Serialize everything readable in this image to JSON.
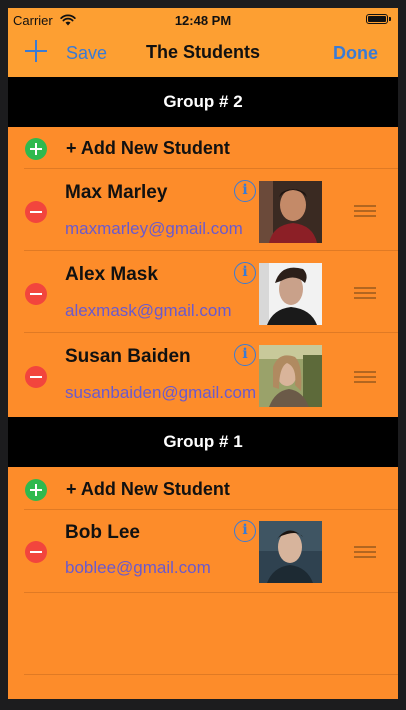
{
  "status_bar": {
    "carrier": "Carrier",
    "time": "12:48 PM"
  },
  "nav": {
    "save_label": "Save",
    "title": "The Students",
    "done_label": "Done"
  },
  "sections": [
    {
      "title": "Group # 2",
      "add_label": "+ Add New Student",
      "students": [
        {
          "name": "Max Marley",
          "email": "maxmarley@gmail.com"
        },
        {
          "name": "Alex Mask",
          "email": "alexmask@gmail.com"
        },
        {
          "name": "Susan Baiden",
          "email": "susanbaiden@gmail.com"
        }
      ]
    },
    {
      "title": "Group # 1",
      "add_label": "+ Add New Student",
      "students": [
        {
          "name": "Bob Lee",
          "email": "boblee@gmail.com"
        }
      ]
    }
  ],
  "colors": {
    "accent": "#3a7bd5",
    "background": "#fd8c2a",
    "navbar": "#fd9f32",
    "add": "#2fb94e",
    "delete": "#f2453d",
    "email": "#6a5acd"
  },
  "icons": {
    "add": "plus-icon",
    "info": "info-icon",
    "reorder": "reorder-grip-icon",
    "wifi": "wifi-icon",
    "battery": "battery-icon"
  }
}
